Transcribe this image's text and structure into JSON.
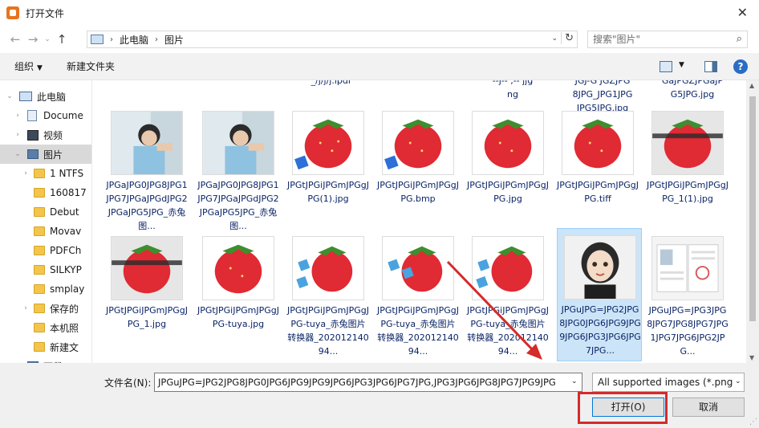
{
  "window": {
    "title": "打开文件",
    "close_glyph": "✕"
  },
  "nav": {
    "back": "←",
    "forward": "→",
    "dropdown": "⌄",
    "up": "↑"
  },
  "address": {
    "crumbs": [
      "此电脑",
      "图片"
    ],
    "sep": "›",
    "dropdown": "⌄",
    "refresh": "↻"
  },
  "search": {
    "placeholder": "搜索\"图片\"",
    "icon": "⌕"
  },
  "toolbar": {
    "organize": "组织",
    "caret": "▼",
    "new_folder": "新建文件夹",
    "help": "?"
  },
  "sidebar": {
    "expander_open": "⌄",
    "expander_closed": "›",
    "items": [
      {
        "label": "此电脑",
        "icon": "pc-icon"
      },
      {
        "label": "Docume",
        "icon": "doc-icon"
      },
      {
        "label": "视频",
        "icon": "video-icon"
      },
      {
        "label": "图片",
        "icon": "picture-icon"
      },
      {
        "label": "1 NTFS",
        "icon": "folder-icon"
      },
      {
        "label": "160817",
        "icon": "folder-icon"
      },
      {
        "label": "Debut",
        "icon": "folder-icon"
      },
      {
        "label": "Movav",
        "icon": "folder-icon"
      },
      {
        "label": "PDFCh",
        "icon": "folder-icon"
      },
      {
        "label": "SILKYP",
        "icon": "folder-icon"
      },
      {
        "label": "smplay",
        "icon": "folder-icon"
      },
      {
        "label": "保存的",
        "icon": "folder-icon"
      },
      {
        "label": "本机照",
        "icon": "folder-icon"
      },
      {
        "label": "新建文",
        "icon": "folder-icon"
      },
      {
        "label": "下载",
        "icon": "folder-icon"
      }
    ]
  },
  "files": {
    "partial_top": [
      {
        "col": 2,
        "lines": [
          "_/j/j/j.ipdr"
        ]
      },
      {
        "col": 4,
        "lines": [
          "--j-- ,-- jjg",
          "ng"
        ]
      },
      {
        "col": 5,
        "lines": [
          "JGJ-G JGZJPG",
          "8JPG_JPG1JPG",
          "JPG5JPG.jpg"
        ]
      },
      {
        "col": 6,
        "lines": [
          "GaJPGZJPGaJP",
          "G5JPG.jpg"
        ]
      }
    ],
    "row1": [
      {
        "name": "JPGaJPG0JPG8JPG1JPG7JPGaJPGdJPG2JPGaJPG5JPG_赤兔图...",
        "thumb": "boy"
      },
      {
        "name": "JPGaJPG0JPG8JPG1JPG7JPGaJPGdJPG2JPGaJPG5JPG_赤兔图...",
        "thumb": "boy"
      },
      {
        "name": "JPGtJPGiJPGmJPGgJPG(1).jpg",
        "thumb": "strawberry"
      },
      {
        "name": "JPGtJPGiJPGmJPGgJPG.bmp",
        "thumb": "strawberry"
      },
      {
        "name": "JPGtJPGiJPGmJPGgJPG.jpg",
        "thumb": "strawberry"
      },
      {
        "name": "JPGtJPGiJPGmJPGgJPG.tiff",
        "thumb": "strawberry"
      },
      {
        "name": "JPGtJPGiJPGmJPGgJPG_1(1).jpg",
        "thumb": "strawberry"
      }
    ],
    "row2": [
      {
        "name": "JPGtJPGiJPGmJPGgJPG_1.jpg",
        "thumb": "strawberry"
      },
      {
        "name": "JPGtJPGiJPGmJPGgJPG-tuya.jpg",
        "thumb": "strawberry"
      },
      {
        "name": "JPGtJPGiJPGmJPGgJPG-tuya_赤兔图片转换器_20201214094...",
        "thumb": "strawberry"
      },
      {
        "name": "JPGtJPGiJPGmJPGgJPG-tuya_赤兔图片转换器_20201214094...",
        "thumb": "strawberry"
      },
      {
        "name": "JPGtJPGiJPGmJPGgJPG-tuya_赤兔图片转换器_20201214094...",
        "thumb": "strawberry"
      },
      {
        "name": "JPGuJPG=JPG2JPG8JPG0JPG6JPG9JPG9JPG6JPG3JPG6JPG7JPG...",
        "thumb": "girl",
        "selected": true
      },
      {
        "name": "JPGuJPG=JPG3JPG8JPG7JPG8JPG7JPG1JPG7JPG6JPG2JPG...",
        "thumb": "document"
      }
    ]
  },
  "scrollbar": {
    "up": "▲",
    "down": "▼"
  },
  "bottom": {
    "filename_label": "文件名(N):",
    "filename_value": "JPGuJPG=JPG2JPG8JPG0JPG6JPG9JPG9JPG6JPG3JPG6JPG7JPG,JPG3JPG6JPG8JPG7JPG9JPG",
    "filename_drop": "⌄",
    "filetype_value": "All supported images (*.png",
    "filetype_drop": "⌄",
    "open_label": "打开(O)",
    "cancel_label": "取消",
    "grip": "⋰"
  },
  "colors": {
    "accent": "#0078d7",
    "selection": "#cce4f7",
    "annotation": "#d42b2b",
    "link_text": "#0a2466"
  }
}
